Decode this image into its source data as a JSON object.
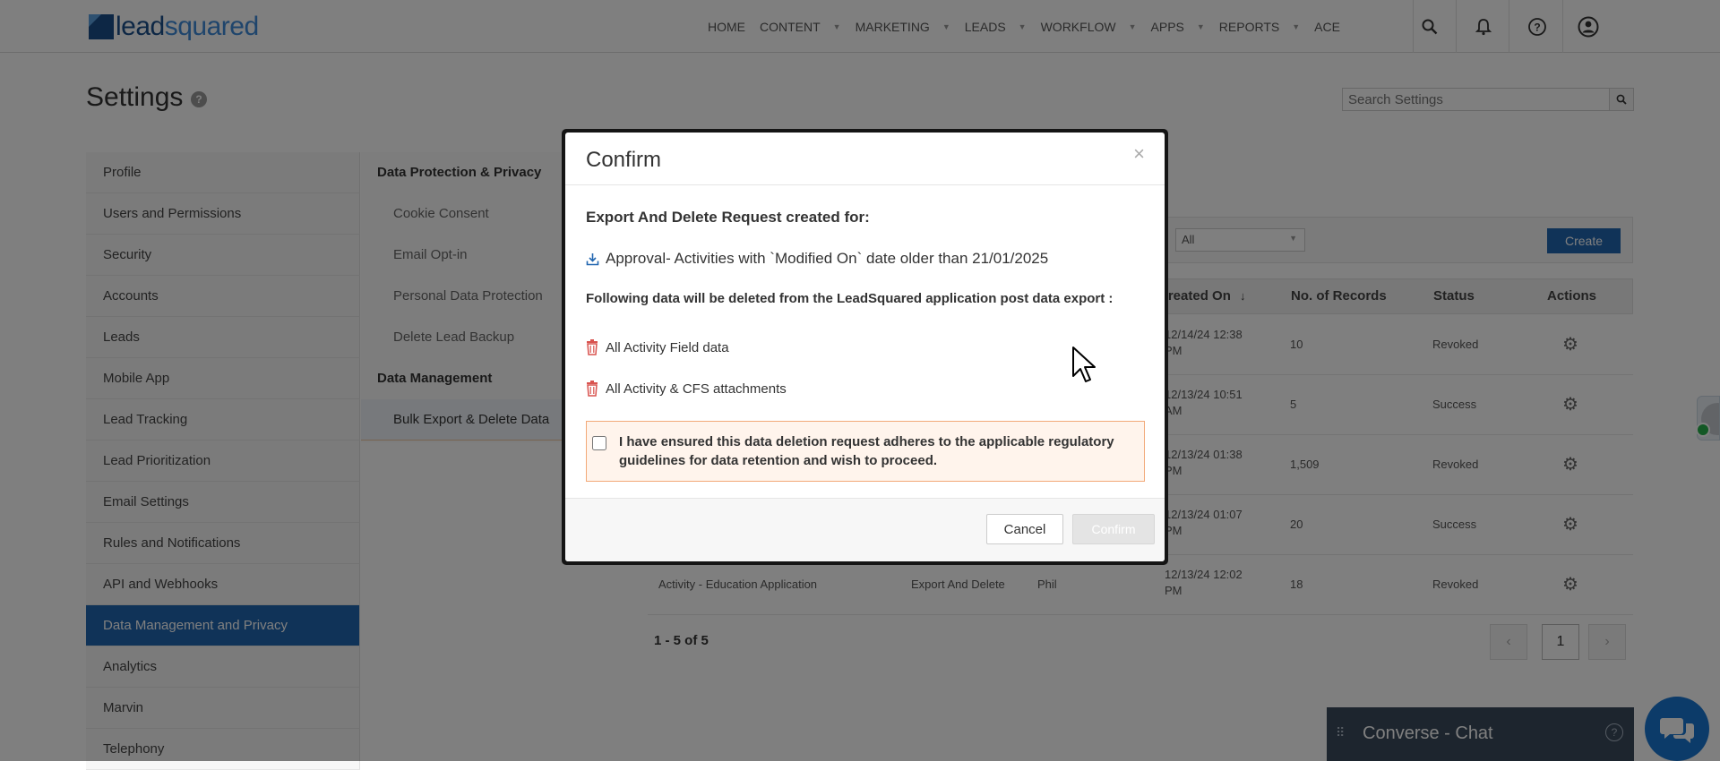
{
  "brand": {
    "logo_part1": "lead",
    "logo_part2": "squared"
  },
  "nav": {
    "items": [
      "HOME",
      "CONTENT",
      "MARKETING",
      "LEADS",
      "WORKFLOW",
      "APPS",
      "REPORTS",
      "ACE"
    ],
    "has_caret": [
      false,
      true,
      true,
      true,
      true,
      true,
      true,
      false
    ]
  },
  "page": {
    "title": "Settings",
    "help": "?"
  },
  "search": {
    "placeholder": "Search Settings"
  },
  "sidebar": {
    "items": [
      "Profile",
      "Users and Permissions",
      "Security",
      "Accounts",
      "Leads",
      "Mobile App",
      "Lead Tracking",
      "Lead Prioritization",
      "Email Settings",
      "Rules and Notifications",
      "API and Webhooks",
      "Data Management and Privacy",
      "Analytics",
      "Marvin",
      "Telephony"
    ],
    "active_index": 11
  },
  "submenu": {
    "group1": "Data Protection & Privacy",
    "group1_items": [
      "Cookie Consent",
      "Email Opt-in",
      "Personal Data Protection",
      "Delete Lead Backup"
    ],
    "group2": "Data Management",
    "group2_items": [
      "Bulk Export & Delete Data"
    ]
  },
  "filters": {
    "selected": "All",
    "create_label": "Create"
  },
  "table": {
    "headers": [
      "Created On",
      "No. of Records",
      "Status",
      "Actions"
    ],
    "sort_icon": "↓",
    "rows": [
      {
        "name": "",
        "type": "",
        "owner": "",
        "created_l1": "12/14/24 12:38",
        "created_l2": "PM",
        "records": "10",
        "status": "Revoked"
      },
      {
        "name": "",
        "type": "",
        "owner": "",
        "created_l1": "12/13/24 10:51",
        "created_l2": "AM",
        "records": "5",
        "status": "Success"
      },
      {
        "name": "",
        "type": "",
        "owner": "",
        "created_l1": "12/13/24 01:38",
        "created_l2": "PM",
        "records": "1,509",
        "status": "Revoked"
      },
      {
        "name": "",
        "type": "",
        "owner": "",
        "created_l1": "12/13/24 01:07",
        "created_l2": "PM",
        "records": "20",
        "status": "Success"
      },
      {
        "name": "Activity - Education Application",
        "type": "Export And Delete",
        "owner": "Phil",
        "created_l1": "12/13/24 12:02",
        "created_l2": "PM",
        "records": "18",
        "status": "Revoked"
      }
    ]
  },
  "pagination": {
    "info": "1 - 5 of 5",
    "current": "1",
    "prev": "‹",
    "next": "›"
  },
  "chat": {
    "title": "Converse - Chat",
    "help": "?"
  },
  "modal": {
    "title": "Confirm",
    "close": "×",
    "heading": "Export And Delete Request created for:",
    "request_item": "Approval- Activities with `Modified On` date older than 21/01/2025",
    "following": "Following data will be deleted from the LeadSquared application post data export :",
    "deleted_items": [
      "All Activity Field data",
      "All Activity & CFS attachments"
    ],
    "consent": "I have ensured this data deletion request adheres to the applicable regulatory guidelines for data retention and wish to proceed.",
    "cancel_label": "Cancel",
    "confirm_label": "Confirm"
  },
  "icons": {
    "search": "search-icon",
    "bell": "bell-icon",
    "help": "help-icon",
    "user": "user-icon",
    "download": "download-icon",
    "trash": "trash-icon",
    "gear": "gear-icon",
    "chat": "chat-icon"
  },
  "colors": {
    "primary": "#2166b0",
    "trash": "#d9534f",
    "consent_border": "#f2a978",
    "consent_bg": "#fff4ec",
    "chat_bar": "#3a4a5c"
  }
}
